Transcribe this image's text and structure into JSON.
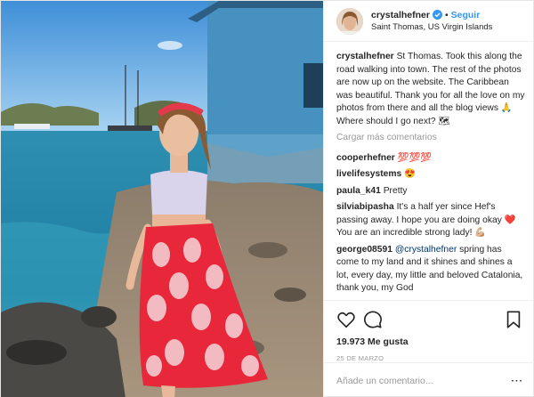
{
  "post": {
    "username": "crystalhefner",
    "separator": "•",
    "follow_label": "Seguir",
    "location": "Saint Thomas, US Virgin Islands",
    "verified_icon": "verified-badge-icon"
  },
  "caption": {
    "username": "crystalhefner",
    "text": "St Thomas. Took this along the road walking into town. The rest of the photos are now up on the website. The Caribbean was beautiful. Thank you for all the love on my photos from there and all the blog views 🙏Where should I go next? 🗺"
  },
  "load_more_label": "Cargar más comentarios",
  "comments": [
    {
      "user": "cooperhefner",
      "text": "💯💯💯"
    },
    {
      "user": "livelifesystems",
      "text": "😍"
    },
    {
      "user": "paula_k41",
      "text": "Pretty"
    },
    {
      "user": "silviabipasha",
      "text": "It's a half yer since Hef's passing away. I hope you are doing okay ❤️ You are an incredible strong lady! 💪🏼"
    },
    {
      "user": "george08591",
      "mention": "@crystalhefner",
      "text": "spring has come to my land and it shines and shines a lot, every day, my little and beloved Catalonia, thank you, my God"
    }
  ],
  "actions": {
    "like_icon": "heart-icon",
    "comment_icon": "comment-icon",
    "save_icon": "bookmark-icon"
  },
  "likes_label": "19.973 Me gusta",
  "date_label": "25 DE MARZO",
  "add_comment": {
    "placeholder": "Añade un comentario...",
    "more_label": "···"
  },
  "colors": {
    "link": "#3897f0",
    "muted": "#999999",
    "text": "#262626",
    "skirt": "#e8283a"
  }
}
